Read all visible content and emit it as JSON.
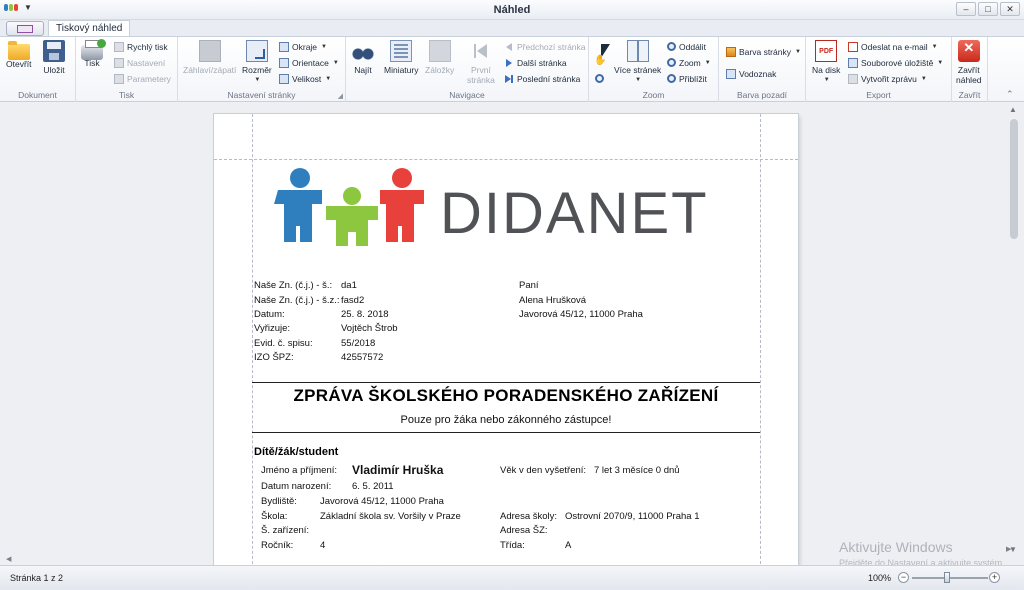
{
  "window": {
    "title": "Náhled",
    "controls": [
      "minimize",
      "maximize",
      "close"
    ]
  },
  "tabs": [
    {
      "label": "Tiskový náhled",
      "active": true
    }
  ],
  "ribbon": {
    "dokument": {
      "label": "Dokument",
      "open": "Otevřít",
      "save": "Uložit"
    },
    "tisk": {
      "label": "Tisk",
      "print": "Tisk",
      "quick_print": "Rychlý tisk",
      "settings": "Nastavení",
      "parameters": "Parametery"
    },
    "nastaveni_stranky": {
      "label": "Nastavení stránky",
      "header_footer": "Záhlaví/zápatí",
      "size": "Rozměr",
      "margins": "Okraje",
      "orientation": "Orientace",
      "scale": "Velikost"
    },
    "navigace": {
      "label": "Navigace",
      "find": "Najít",
      "thumbnails": "Miniatury",
      "bookmarks": "Záložky",
      "first_page_l1": "První",
      "first_page_l2": "stránka",
      "prev_page": "Předchozí stránka",
      "next_page": "Další stránka",
      "last_page": "Poslední stránka"
    },
    "zoom": {
      "label": "Zoom",
      "multi_page": "Více stránek",
      "zoom_out": "Oddálit",
      "zoom": "Zoom",
      "zoom_in": "Přiblížit"
    },
    "barva_pozadi": {
      "label": "Barva pozadí",
      "page_color": "Barva stránky",
      "watermark": "Vodoznak"
    },
    "export": {
      "label": "Export",
      "to_disk_l1": "Na disk",
      "send_email": "Odeslat na e-mail",
      "file_storage": "Souborové úložiště",
      "create_report": "Vytvořit zprávu"
    },
    "zavrit": {
      "label": "Zavřít",
      "close_l1": "Zavřít",
      "close_l2": "náhled"
    }
  },
  "document": {
    "logo_text": "DIDANET",
    "meta_rows": [
      {
        "label": "Naše Zn. (č.j.) - š.:",
        "value": "da1"
      },
      {
        "label": "Naše Zn. (č.j.) - š.z.:",
        "value": "fasd2"
      },
      {
        "label": "Datum:",
        "value": "25. 8. 2018"
      },
      {
        "label": "Vyřizuje:",
        "value": "Vojtěch Štrob"
      },
      {
        "label": "Evid. č. spisu:",
        "value": "55/2018"
      },
      {
        "label": "IZO ŠPZ:",
        "value": "42557572"
      }
    ],
    "recipient": [
      "Paní",
      "Alena Hrušková",
      "Javorová 45/12, 11000 Praha"
    ],
    "title": "ZPRÁVA ŠKOLSKÉHO PORADENSKÉHO ZAŘÍZENÍ",
    "subtitle": "Pouze pro žáka nebo zákonného zástupce!",
    "section": "Dítě/žák/student",
    "student": {
      "name_label": "Jméno a příjmení:",
      "name": "Vladimír Hruška",
      "dob_label": "Datum narození:",
      "dob": "6. 5. 2011",
      "residence_label": "Bydliště:",
      "residence": "Javorová 45/12, 11000 Praha",
      "school_label": "Škola:",
      "school": "Základní škola sv. Voršily v Praze",
      "facility_label": "Š. zařízení:",
      "grade_label": "Ročník:",
      "grade": "4",
      "age_label": "Věk v den vyšetření:",
      "age": "7 let 3 měsíce 0 dnů",
      "school_address_label": "Adresa školy:",
      "school_address": "Ostrovní 2070/9, 11000 Praha 1",
      "sz_address_label": "Adresa ŠZ:",
      "class_label": "Třída:",
      "class": "A"
    }
  },
  "watermark": {
    "title": "Aktivujte Windows",
    "subtitle": "Přejděte do Nastavení a aktivujte systém"
  },
  "status": {
    "page": "Stránka 1 z 2",
    "zoom": "100%"
  },
  "colors": {
    "logo_blue": "#2f7fbf",
    "logo_green": "#8dc63f",
    "logo_red": "#e8403a",
    "logo_text": "#505256",
    "accent": "#2d5fa0"
  }
}
